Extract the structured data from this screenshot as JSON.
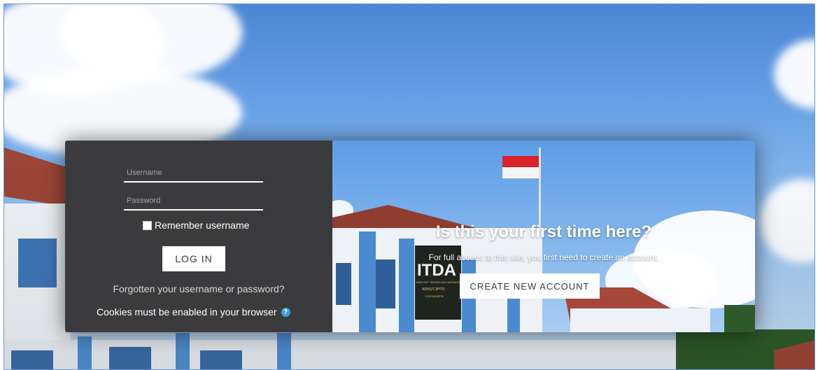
{
  "login": {
    "username_placeholder": "Username",
    "password_placeholder": "Password",
    "remember_label": "Remember username",
    "login_button": "LOG IN",
    "forgot_link": "Forgotten your username or password?",
    "cookies_text": "Cookies must be enabled in your browser"
  },
  "signup": {
    "title": "Is this your first time here?",
    "subtitle": "For full access to this site, you first need to create an account.",
    "create_button": "CREATE NEW ACCOUNT"
  },
  "sign": {
    "letters": "ITDA",
    "line1": "INSTITUT TEKNOLOGI DIRGANTARA",
    "line2": "ADISUTJIPTO",
    "line3": "YOGYAKARTA"
  },
  "colors": {
    "panel": "#3b3b3d",
    "help_icon": "#3aa0e0"
  },
  "icons": {
    "help": "question-circle-icon",
    "checkbox": "checkbox-unchecked"
  }
}
